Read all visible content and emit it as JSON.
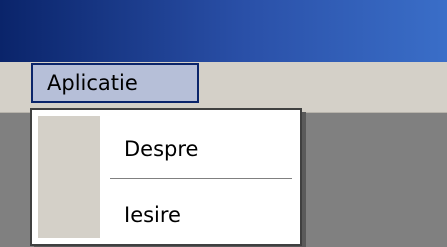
{
  "menubar": {
    "items": [
      {
        "label": "Aplicatie"
      }
    ]
  },
  "dropdown": {
    "options": [
      {
        "label": "Despre"
      },
      {
        "label": "Iesire"
      }
    ]
  },
  "colors": {
    "titlebar_start": "#0a246a",
    "titlebar_end": "#3a6ec8",
    "menubar": "#d4d0c8",
    "menu_highlight": "#b6bfd8",
    "workspace": "#808080"
  }
}
